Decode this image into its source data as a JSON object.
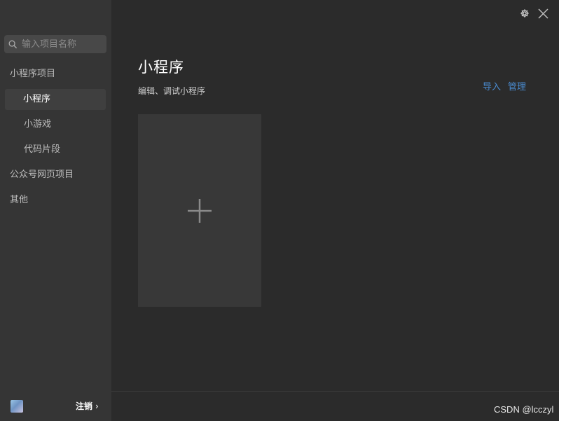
{
  "search": {
    "placeholder": "输入项目名称"
  },
  "sidebar": {
    "items": [
      {
        "label": "小程序项目"
      },
      {
        "label": "小程序"
      },
      {
        "label": "小游戏"
      },
      {
        "label": "代码片段"
      },
      {
        "label": "公众号网页项目"
      },
      {
        "label": "其他"
      }
    ],
    "footer": {
      "logout_label": "注销",
      "chevron": "›"
    }
  },
  "main": {
    "title": "小程序",
    "subtitle": "编辑、调试小程序",
    "import_label": "导入",
    "manage_label": "管理"
  },
  "watermark": "CSDN @lcczyl",
  "colors": {
    "accent": "#4a8bd0",
    "sidebar_bg": "#353535",
    "main_bg": "#2b2b2b",
    "card_bg": "#383838"
  },
  "icons": {
    "search": "search-icon",
    "settings": "gear-icon",
    "close": "close-icon",
    "add": "plus-icon",
    "user": "avatar"
  }
}
